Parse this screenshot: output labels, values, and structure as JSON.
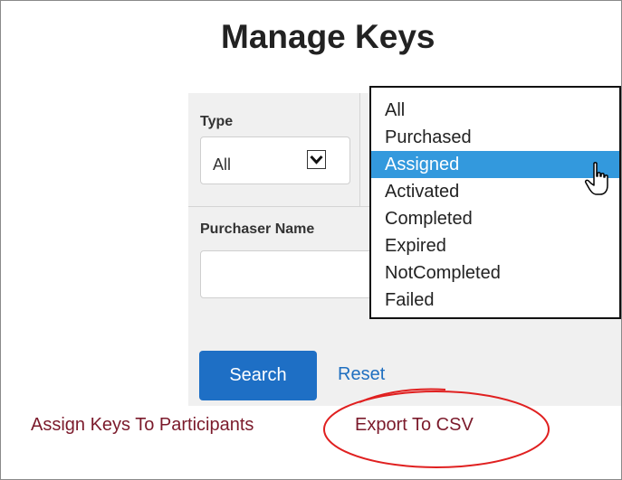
{
  "page": {
    "title": "Manage Keys"
  },
  "filters": {
    "type_label": "Type",
    "type_value": "All",
    "purchaser_label": "Purchaser Name",
    "purchaser_value": ""
  },
  "dropdown": {
    "selected": "Assigned",
    "options": [
      "All",
      "Purchased",
      "Assigned",
      "Activated",
      "Completed",
      "Expired",
      "NotCompleted",
      "Failed"
    ]
  },
  "actions": {
    "search_label": "Search",
    "reset_label": "Reset",
    "assign_label": "Assign Keys To Participants",
    "export_label": "Export To CSV"
  },
  "colors": {
    "search_button": "#1e6fc5",
    "selected_option": "#3399dd",
    "link_maroon": "#7b1a2b",
    "annotation_ellipse": "#e02020"
  },
  "icons": {
    "select_arrow": "chevron-down-icon",
    "cursor": "hand-pointer-icon"
  }
}
